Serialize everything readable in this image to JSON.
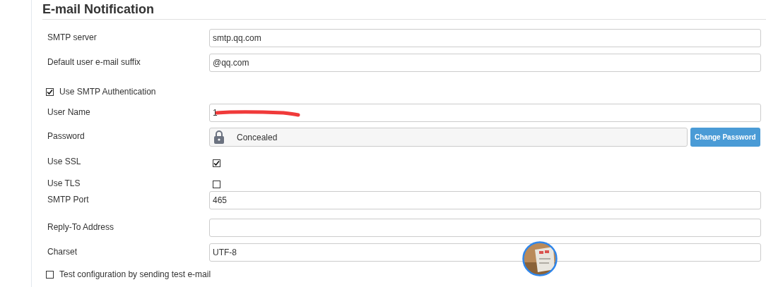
{
  "section": {
    "title": "E-mail Notification"
  },
  "rows": [
    {
      "kind": "text",
      "label": "SMTP server",
      "value": "smtp.qq.com"
    },
    {
      "kind": "text",
      "label": "Default user e-mail suffix",
      "value": "@qq.com"
    },
    {
      "kind": "option",
      "label": "Use SMTP Authentication",
      "checked": true
    },
    {
      "kind": "text",
      "label": "User Name",
      "value": "1",
      "redacted": true
    },
    {
      "kind": "password",
      "label": "Password",
      "value": "Concealed",
      "button": "Change Password"
    },
    {
      "kind": "checkbox",
      "label": "Use SSL",
      "checked": true
    },
    {
      "kind": "checkbox",
      "label": "Use TLS",
      "checked": false
    },
    {
      "kind": "text",
      "label": "SMTP Port",
      "value": "465"
    },
    {
      "kind": "text",
      "label": "Reply-To Address"
    },
    {
      "kind": "text",
      "label": "Charset",
      "value": "UTF-8"
    },
    {
      "kind": "option",
      "label": "Test configuration by sending test e-mail",
      "checked": false
    }
  ]
}
